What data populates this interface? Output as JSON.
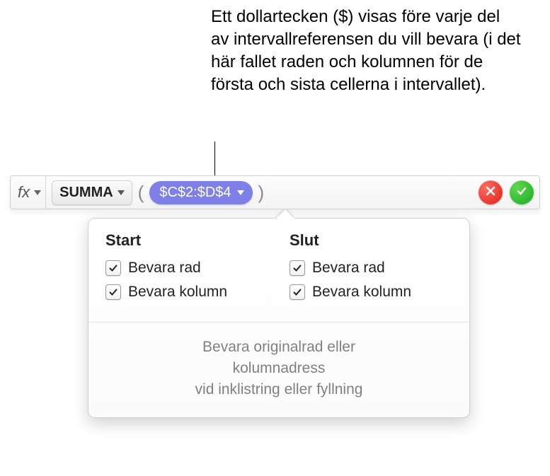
{
  "callout": {
    "text": "Ett dollartecken ($) visas före varje del av intervallreferensen du vill bevara (i det här fallet raden och kolumnen för de första och sista cellerna i intervallet)."
  },
  "formula_bar": {
    "fx_label": "fx",
    "function_name": "SUMMA",
    "open_paren": "(",
    "close_paren": ")",
    "range_reference": "$C$2:$D$4"
  },
  "popover": {
    "start": {
      "heading": "Start",
      "preserve_row": "Bevara rad",
      "preserve_col": "Bevara kolumn",
      "row_checked": true,
      "col_checked": true
    },
    "end": {
      "heading": "Slut",
      "preserve_row": "Bevara rad",
      "preserve_col": "Bevara kolumn",
      "row_checked": true,
      "col_checked": true
    },
    "footer_line1": "Bevara originalrad eller",
    "footer_line2": "kolumnadress",
    "footer_line3": "vid inklistring eller fyllning"
  }
}
